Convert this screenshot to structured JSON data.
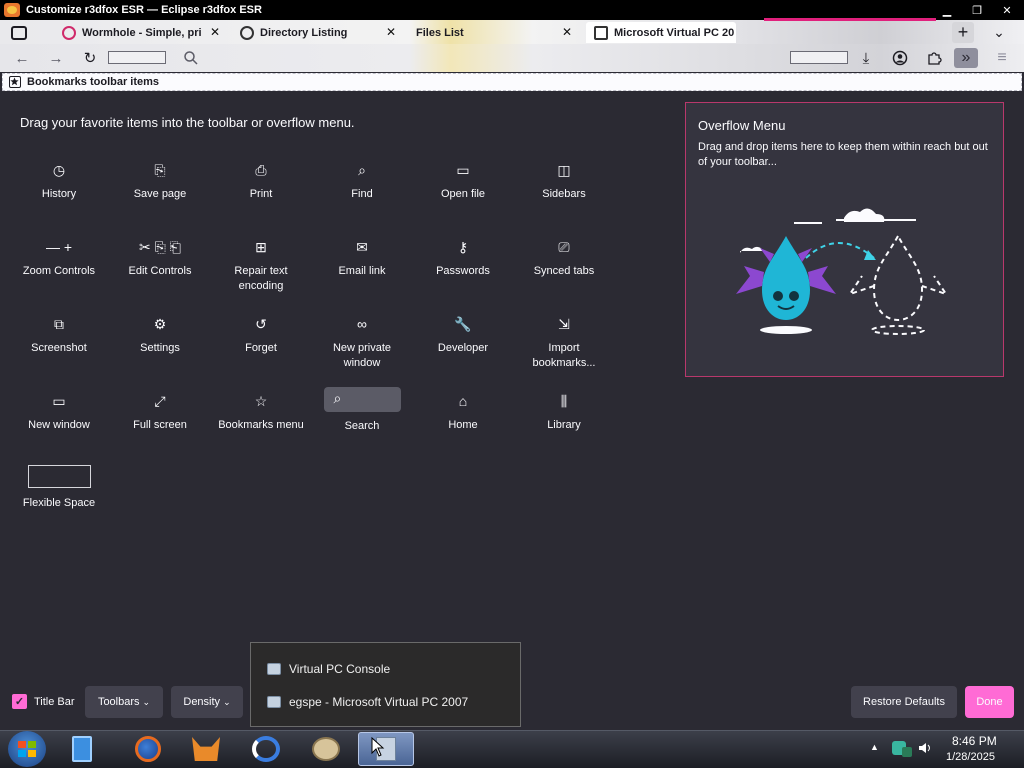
{
  "window": {
    "title": "Customize r3dfox ESR — Eclipse r3dfox ESR",
    "controls": {
      "minimize": "▁",
      "maximize": "❐",
      "close": "✕"
    }
  },
  "tabs": [
    {
      "label": "Wormhole - Simple, pri",
      "icon": "wormhole-icon"
    },
    {
      "label": "Directory Listing",
      "icon": "info-icon"
    },
    {
      "label": "Files List",
      "icon": ""
    },
    {
      "label": "Microsoft Virtual PC 20",
      "icon": "page-icon"
    }
  ],
  "tab_new_label": "+",
  "tab_list_label": "⌄",
  "navbar": {
    "back": "←",
    "forward": "→",
    "reload": "↻",
    "search_icon": "search-icon",
    "downloads": "⤓",
    "account": "account-icon",
    "extensions": "extensions-icon",
    "overflow": "»",
    "menu": "≡"
  },
  "bookmarks": {
    "label": "Bookmarks toolbar items"
  },
  "customize": {
    "instructions": "Drag your favorite items into the toolbar or overflow menu.",
    "items": [
      {
        "label": "History",
        "glyph": "◷"
      },
      {
        "label": "Save page",
        "glyph": "⎘"
      },
      {
        "label": "Print",
        "glyph": "⎙"
      },
      {
        "label": "Find",
        "glyph": "⌕"
      },
      {
        "label": "Open file",
        "glyph": "▭"
      },
      {
        "label": "Sidebars",
        "glyph": "◫"
      },
      {
        "label": "Zoom Controls",
        "glyph": "— +"
      },
      {
        "label": "Edit Controls",
        "glyph": "✂ ⎘ ⎗"
      },
      {
        "label": "Repair text encoding",
        "glyph": "⊞"
      },
      {
        "label": "Email link",
        "glyph": "✉"
      },
      {
        "label": "Passwords",
        "glyph": "⚷"
      },
      {
        "label": "Synced tabs",
        "glyph": "⎚"
      },
      {
        "label": "Screenshot",
        "glyph": "⧉"
      },
      {
        "label": "Settings",
        "glyph": "⚙"
      },
      {
        "label": "Forget",
        "glyph": "↺"
      },
      {
        "label": "New private window",
        "glyph": "∞"
      },
      {
        "label": "Developer",
        "glyph": "🔧"
      },
      {
        "label": "Import bookmarks...",
        "glyph": "⇲"
      },
      {
        "label": "New window",
        "glyph": "▭"
      },
      {
        "label": "Full screen",
        "glyph": "⤢"
      },
      {
        "label": "Bookmarks menu",
        "glyph": "☆"
      },
      {
        "label": "Search",
        "glyph": "⌕"
      },
      {
        "label": "Home",
        "glyph": "⌂"
      },
      {
        "label": "Library",
        "glyph": "⫼"
      },
      {
        "label": "Flexible Space",
        "glyph": ""
      }
    ]
  },
  "overflow_menu": {
    "title": "Overflow Menu",
    "description": "Drag and drop items here to keep them within reach but out of your toolbar..."
  },
  "bottom": {
    "title_bar_label": "Title Bar",
    "title_bar_checked": true,
    "toolbars_label": "Toolbars",
    "density_label": "Density",
    "restore_label": "Restore Defaults",
    "done_label": "Done"
  },
  "popup": {
    "items": [
      {
        "label": "Virtual PC Console"
      },
      {
        "label": "egspe - Microsoft Virtual PC 2007"
      }
    ]
  },
  "taskbar": {
    "time": "8:46 PM",
    "date": "1/28/2025"
  },
  "colors": {
    "accent": "#ff6bd5",
    "panel_border": "#b9386c",
    "background": "#2b2a33"
  }
}
